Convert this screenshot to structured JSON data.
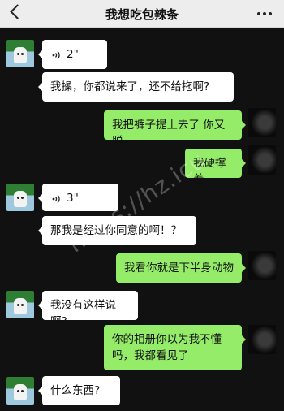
{
  "header": {
    "title": "我想吃包辣条"
  },
  "messages": [
    {
      "side": "left",
      "type": "voice",
      "duration": "2\""
    },
    {
      "side": "left",
      "type": "text",
      "text": "我操，你都说来了，还不给拖啊?"
    },
    {
      "side": "right",
      "type": "text",
      "text": "我把裤子提上去了 你又脱"
    },
    {
      "side": "right",
      "type": "text",
      "text": "我硬撑着"
    },
    {
      "side": "left",
      "type": "voice",
      "duration": "3\""
    },
    {
      "side": "left",
      "type": "text",
      "text": "那我是经过你同意的啊！？"
    },
    {
      "side": "right",
      "type": "text",
      "text": "我看你就是下半身动物"
    },
    {
      "side": "left",
      "type": "text",
      "text": "我没有这样说啊?"
    },
    {
      "side": "right",
      "type": "text",
      "text": "你的相册你以为我不懂吗，我都看见了"
    },
    {
      "side": "left",
      "type": "text",
      "text": "什么东西?"
    }
  ],
  "watermark": "https://hz.icu",
  "colors": {
    "right_bubble": "#95ec69",
    "left_bubble": "#ffffff",
    "background": "#111111",
    "header": "#ededed"
  }
}
